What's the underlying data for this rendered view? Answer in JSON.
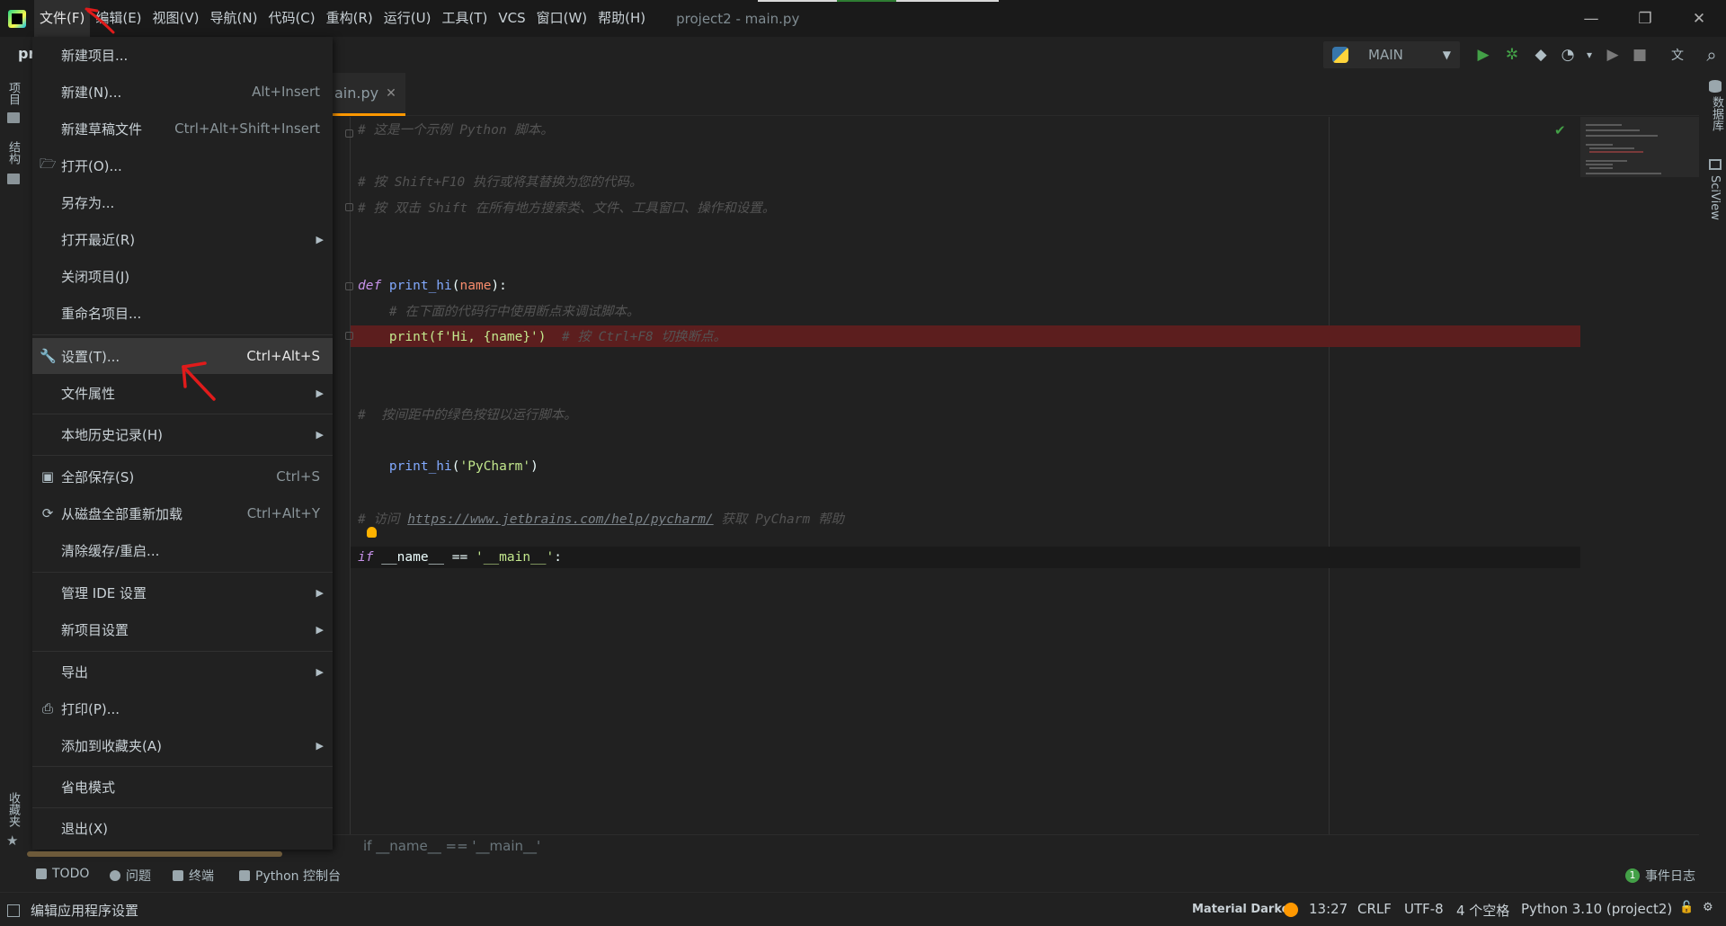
{
  "titlebar": {
    "menus": [
      "文件(F)",
      "编辑(E)",
      "视图(V)",
      "导航(N)",
      "代码(C)",
      "重构(R)",
      "运行(U)",
      "工具(T)",
      "VCS",
      "窗口(W)",
      "帮助(H)"
    ],
    "window_title": "project2 - main.py",
    "minimize": "—",
    "restore": "❐",
    "close": "✕"
  },
  "nav": {
    "crumb": "pr",
    "run_config": "MAIN"
  },
  "toolbar_icons": {
    "run": "▶",
    "debug": "✲",
    "coverage": "◆",
    "profile": "◔",
    "dropdown": "▾",
    "run_alt": "▶",
    "stop": "■",
    "translate": "文",
    "search": "⌕"
  },
  "left_strip": {
    "project": "项目",
    "structure": "结构",
    "favorites": "收藏夹"
  },
  "right_strip": {
    "database": "数据库",
    "sciview": "SciView"
  },
  "editor": {
    "tab_label": "ain.py",
    "tab_close": "✕",
    "lines": [
      {
        "cmt": "# 这是一个示例 Python 脚本。"
      },
      {
        "cmt": "# 按 Shift+F10 执行或将其替换为您的代码。"
      },
      {
        "cmt": "# 按 双击 Shift 在所有地方搜索类、文件、工具窗口、操作和设置。"
      },
      {
        "kw": "def ",
        "fn": "print_hi",
        "p1": "(",
        "param": "name",
        "p2": "):"
      },
      {
        "cmt": "    # 在下面的代码行中使用断点来调试脚本。"
      },
      {
        "code": "    print(f'Hi, {name}')  ",
        "cmt": "# 按 Ctrl+F8 切换断点。"
      },
      {
        "cmt": "#  按间距中的绿色按钮以运行脚本。"
      },
      {
        "kw": "if ",
        "plain": "__name__ == ",
        "str": "'__main__'",
        "end": ":"
      },
      {
        "fn": "    print_hi",
        "p1": "(",
        "str": "'PyCharm'",
        "p2": ")"
      },
      {
        "cmt": "# 访问 ",
        "url": "https://www.jetbrains.com/help/pycharm/",
        "cmt2": " 获取 PyCharm 帮助"
      }
    ],
    "breadcrumb": "if __name__ == '__main__'"
  },
  "file_menu": {
    "items": [
      {
        "label": "新建项目...",
        "shortcut": ""
      },
      {
        "label": "新建(N)...",
        "shortcut": "Alt+Insert"
      },
      {
        "label": "新建草稿文件",
        "shortcut": "Ctrl+Alt+Shift+Insert"
      },
      {
        "label": "打开(O)...",
        "shortcut": ""
      },
      {
        "label": "另存为...",
        "shortcut": ""
      },
      {
        "label": "打开最近(R)",
        "shortcut": ""
      },
      {
        "label": "关闭项目(J)",
        "shortcut": ""
      },
      {
        "label": "重命名项目...",
        "shortcut": ""
      },
      {
        "label": "设置(T)...",
        "shortcut": "Ctrl+Alt+S"
      },
      {
        "label": "文件属性",
        "shortcut": ""
      },
      {
        "label": "本地历史记录(H)",
        "shortcut": ""
      },
      {
        "label": "全部保存(S)",
        "shortcut": "Ctrl+S"
      },
      {
        "label": "从磁盘全部重新加载",
        "shortcut": "Ctrl+Alt+Y"
      },
      {
        "label": "清除缓存/重启...",
        "shortcut": ""
      },
      {
        "label": "管理 IDE 设置",
        "shortcut": ""
      },
      {
        "label": "新项目设置",
        "shortcut": ""
      },
      {
        "label": "导出",
        "shortcut": ""
      },
      {
        "label": "打印(P)...",
        "shortcut": ""
      },
      {
        "label": "添加到收藏夹(A)",
        "shortcut": ""
      },
      {
        "label": "省电模式",
        "shortcut": ""
      },
      {
        "label": "退出(X)",
        "shortcut": ""
      }
    ],
    "submenu_arrow": "▶",
    "icons": {
      "open": "📂",
      "settings": "🔧",
      "save": "💾",
      "reload": "⟳",
      "print": "🖶"
    }
  },
  "tool_windows": {
    "todo": "TODO",
    "problems": "问题",
    "terminal": "终端",
    "python_console": "Python 控制台",
    "event_log": "事件日志",
    "event_count": "1"
  },
  "statusbar": {
    "message": "编辑应用程序设置",
    "theme": "Material Darker",
    "position": "13:27",
    "line_sep": "CRLF",
    "encoding": "UTF-8",
    "indent": "4 个空格",
    "interpreter": "Python 3.10 (project2)"
  },
  "colors": {
    "accent_orange": "#ff9800",
    "error_line": "#5c1e1e",
    "run_green": "#43a047",
    "annotation_red": "#e01b1b"
  }
}
